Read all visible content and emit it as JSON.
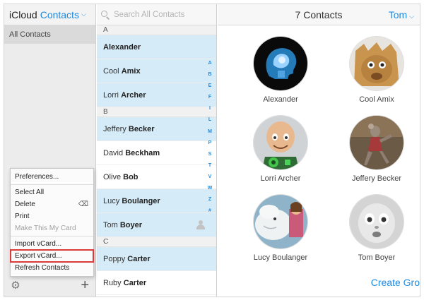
{
  "sidebar": {
    "brand": "iCloud",
    "app_name": "Contacts",
    "groups": [
      {
        "label": "All Contacts"
      }
    ]
  },
  "context_menu": {
    "items": [
      {
        "label": "Preferences..."
      },
      {
        "label": "Select All"
      },
      {
        "label": "Delete"
      },
      {
        "label": "Print"
      },
      {
        "label": "Make This My Card",
        "disabled": true
      },
      {
        "label": "Import vCard..."
      },
      {
        "label": "Export vCard...",
        "highlighted": true
      },
      {
        "label": "Refresh Contacts"
      }
    ]
  },
  "search": {
    "placeholder": "Search All Contacts"
  },
  "list": {
    "sections": [
      {
        "letter": "A",
        "rows": [
          {
            "first": "",
            "last": "Alexander"
          },
          {
            "first": "Cool",
            "last": "Amix"
          },
          {
            "first": "Lorri",
            "last": "Archer"
          }
        ]
      },
      {
        "letter": "B",
        "rows": [
          {
            "first": "Jeffery",
            "last": "Becker"
          },
          {
            "first": "David",
            "last": "Beckham"
          },
          {
            "first": "Olive",
            "last": "Bob"
          },
          {
            "first": "Lucy",
            "last": "Boulanger"
          },
          {
            "first": "Tom",
            "last": "Boyer"
          }
        ]
      },
      {
        "letter": "C",
        "rows": [
          {
            "first": "Poppy",
            "last": "Carter"
          },
          {
            "first": "Ruby",
            "last": "Carter"
          }
        ]
      }
    ],
    "alpha_index": [
      "A",
      "B",
      "E",
      "F",
      "I",
      "L",
      "M",
      "P",
      "S",
      "T",
      "V",
      "W",
      "Z",
      "#"
    ]
  },
  "cards": {
    "title": "7 Contacts",
    "account": "Tom",
    "contacts": [
      {
        "name": "Alexander"
      },
      {
        "name": "Cool Amix"
      },
      {
        "name": "Lorri Archer"
      },
      {
        "name": "Jeffery Becker"
      },
      {
        "name": "Lucy Boulanger"
      },
      {
        "name": "Tom Boyer"
      }
    ],
    "create_group": "Create Gro"
  },
  "colors": {
    "accent": "#1d8ae0",
    "selected_row": "#d6ebf8",
    "highlight_box": "#d93a3a"
  }
}
